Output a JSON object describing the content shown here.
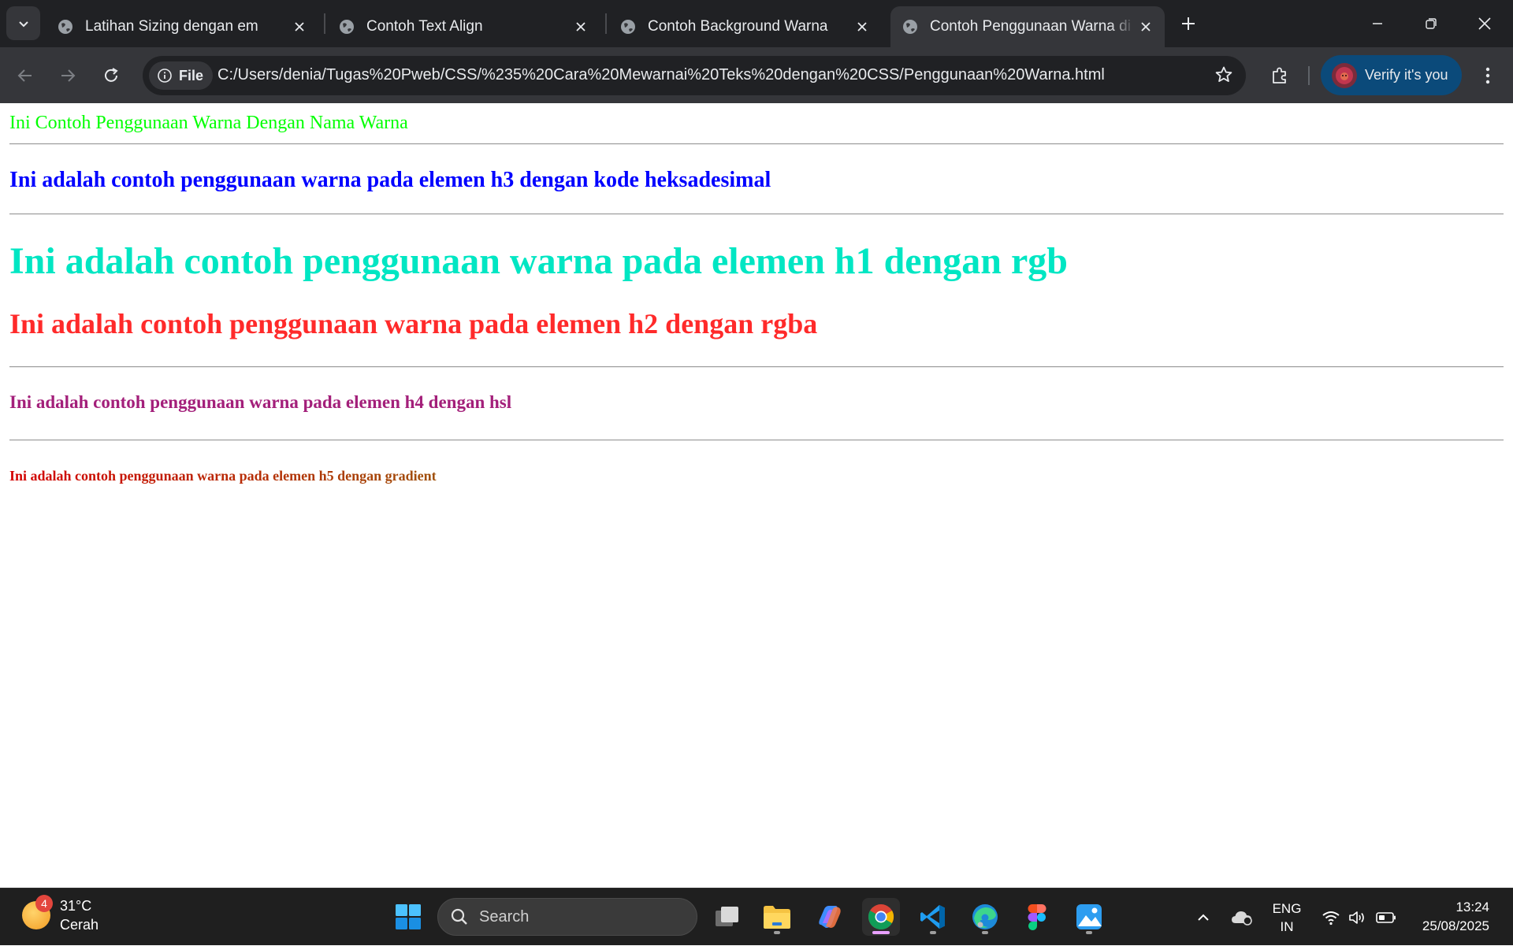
{
  "browser": {
    "tabs": [
      {
        "title": "Latihan Sizing dengan em"
      },
      {
        "title": "Contoh Text Align"
      },
      {
        "title": "Contoh Background Warna"
      },
      {
        "title": "Contoh Penggunaan Warna di C"
      }
    ],
    "site_chip": "File",
    "url": "C:/Users/denia/Tugas%20Pweb/CSS/%235%20Cara%20Mewarnai%20Teks%20dengan%20CSS/Penggunaan%20Warna.html",
    "profile_label": "Verify it's you"
  },
  "page": {
    "p_named": "Ini Contoh Penggunaan Warna Dengan Nama Warna",
    "h3_hex": "Ini adalah contoh penggunaan warna pada elemen h3 dengan kode heksadesimal",
    "h1_rgb": "Ini adalah contoh penggunaan warna pada elemen h1 dengan rgb",
    "h2_rgba": "Ini adalah contoh penggunaan warna pada elemen h2 dengan rgba",
    "h4_hsl": "Ini adalah contoh penggunaan warna pada elemen h4 dengan hsl",
    "h5_gradient": "Ini adalah contoh penggunaan warna pada elemen h5 dengan gradient"
  },
  "colors": {
    "named": "#00ff00",
    "hex": "#0000ff",
    "rgb": "#00e6c3",
    "rgba": "#ff2a2a",
    "hsl": "#a31f7a",
    "gradient_start": "#d40000",
    "gradient_end": "#a0500a"
  },
  "taskbar": {
    "weather_badge": "4",
    "temperature": "31°C",
    "condition": "Cerah",
    "search_placeholder": "Search",
    "lang_line1": "ENG",
    "lang_line2": "IN",
    "time": "13:24",
    "date": "25/08/2025",
    "icons": [
      "start-icon",
      "task-view-icon",
      "file-explorer-icon",
      "copilot-icon",
      "chrome-icon",
      "vscode-icon",
      "edge-icon",
      "figma-icon",
      "photos-icon"
    ]
  }
}
